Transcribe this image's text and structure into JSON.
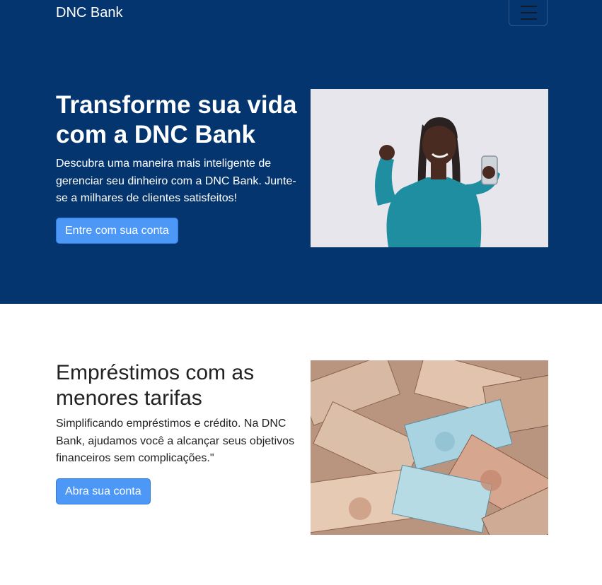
{
  "navbar": {
    "brand": "DNC Bank"
  },
  "hero": {
    "title": "Transforme sua vida com a DNC Bank",
    "text": "Descubra uma maneira mais inteligente de gerenciar seu dinheiro com a DNC Bank. Junte-se a milhares de clientes satisfeitos!",
    "button_label": "Entre com sua conta"
  },
  "loans": {
    "title": "Empréstimos com as menores tarifas",
    "text": "Simplificando empréstimos e crédito. Na DNC Bank, ajudamos você a alcançar seus objetivos financeiros sem complicações.\"",
    "button_label": "Abra sua conta"
  },
  "colors": {
    "hero_bg": "#04356f",
    "button": "#4d97f7",
    "accent_teal": "#1b8a9e"
  },
  "icons": {
    "menu": "hamburger-icon"
  }
}
